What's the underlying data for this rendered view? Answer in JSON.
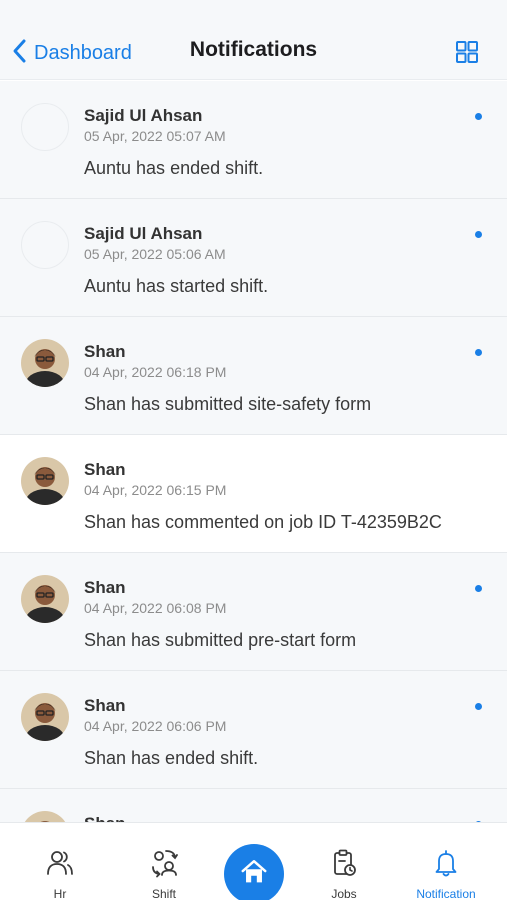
{
  "header": {
    "back_label": "Dashboard",
    "title": "Notifications",
    "back_icon": "chevron-left-icon",
    "menu_icon": "grid-icon",
    "accent_color": "#1a7fe6"
  },
  "notifications": [
    {
      "sender": "Sajid Ul Ahsan",
      "date": "05 Apr, 2022 05:07 AM",
      "message": "Auntu has ended shift.",
      "unread": true,
      "avatar": "empty"
    },
    {
      "sender": "Sajid Ul Ahsan",
      "date": "05 Apr, 2022 05:06 AM",
      "message": "Auntu has started shift.",
      "unread": true,
      "avatar": "empty"
    },
    {
      "sender": "Shan",
      "date": "04 Apr, 2022 06:18 PM",
      "message": "Shan has submitted site-safety form",
      "unread": true,
      "avatar": "photo"
    },
    {
      "sender": "Shan",
      "date": "04 Apr, 2022 06:15 PM",
      "message": "Shan has commented on job ID T-42359B2C",
      "unread": false,
      "avatar": "photo"
    },
    {
      "sender": "Shan",
      "date": "04 Apr, 2022 06:08 PM",
      "message": "Shan has submitted pre-start form",
      "unread": true,
      "avatar": "photo"
    },
    {
      "sender": "Shan",
      "date": "04 Apr, 2022 06:06 PM",
      "message": "Shan has ended shift.",
      "unread": true,
      "avatar": "photo"
    },
    {
      "sender": "Shan",
      "date": "",
      "message": "",
      "unread": true,
      "avatar": "photo"
    }
  ],
  "tabbar": {
    "tabs": [
      {
        "label": "Hr",
        "icon": "people-icon",
        "active": false
      },
      {
        "label": "Shift",
        "icon": "shift-swap-icon",
        "active": false
      },
      {
        "label": "Jobs",
        "icon": "clipboard-icon",
        "active": false
      },
      {
        "label": "Notification",
        "icon": "bell-icon",
        "active": true
      }
    ],
    "home_icon": "home-icon"
  }
}
